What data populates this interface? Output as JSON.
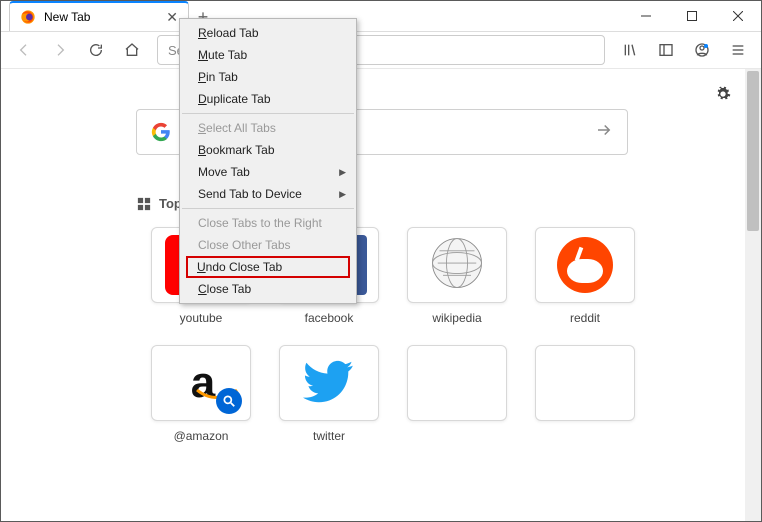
{
  "tab": {
    "title": "New Tab"
  },
  "urlbar": {
    "placeholder": "Search or enter address"
  },
  "topsites_label": "Top Sites",
  "context_menu": {
    "items": [
      {
        "label": "Reload Tab",
        "enabled": true,
        "underline": true
      },
      {
        "label": "Mute Tab",
        "enabled": true,
        "underline": true
      },
      {
        "label": "Pin Tab",
        "enabled": true,
        "underline": true
      },
      {
        "label": "Duplicate Tab",
        "enabled": true,
        "underline": true
      },
      {
        "sep": true
      },
      {
        "label": "Select All Tabs",
        "enabled": false,
        "underline": true
      },
      {
        "label": "Bookmark Tab",
        "enabled": true,
        "underline": true
      },
      {
        "label": "Move Tab",
        "enabled": true,
        "submenu": true
      },
      {
        "label": "Send Tab to Device",
        "enabled": true,
        "submenu": true
      },
      {
        "sep": true
      },
      {
        "label": "Close Tabs to the Right",
        "enabled": false
      },
      {
        "label": "Close Other Tabs",
        "enabled": false
      },
      {
        "label": "Undo Close Tab",
        "enabled": true,
        "highlight": true,
        "underline": true
      },
      {
        "label": "Close Tab",
        "enabled": true,
        "underline": true
      }
    ]
  },
  "tiles": [
    {
      "label": "youtube",
      "icon": "youtube"
    },
    {
      "label": "facebook",
      "icon": "facebook"
    },
    {
      "label": "wikipedia",
      "icon": "wikipedia"
    },
    {
      "label": "reddit",
      "icon": "reddit"
    },
    {
      "label": "@amazon",
      "icon": "amazon"
    },
    {
      "label": "twitter",
      "icon": "twitter"
    },
    {
      "label": "",
      "icon": ""
    },
    {
      "label": "",
      "icon": ""
    }
  ]
}
